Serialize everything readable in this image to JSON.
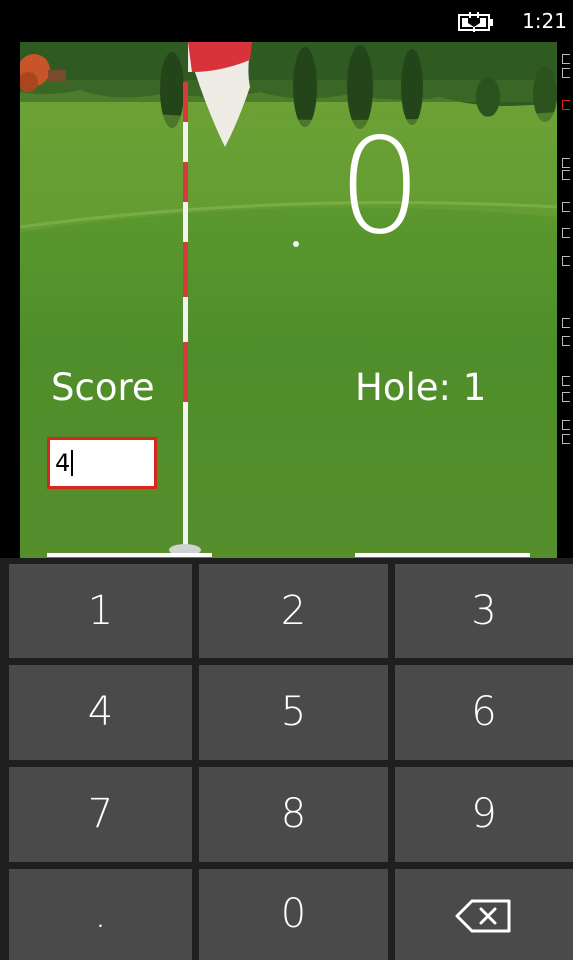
{
  "status_bar": {
    "time": "1:21",
    "battery_icon": "battery-charging-icon"
  },
  "game": {
    "total_score": "0",
    "score_label": "Score",
    "hole_label": "Hole: 1",
    "score_input_value": "4"
  },
  "keypad": {
    "keys": [
      "1",
      "2",
      "3",
      "4",
      "5",
      "6",
      "7",
      "8",
      "9",
      ".",
      "0"
    ],
    "backspace_icon": "backspace-icon"
  },
  "colors": {
    "input_border": "#d8261c",
    "key_background": "#4a4a4a",
    "keypad_background": "#1f1f1f"
  }
}
